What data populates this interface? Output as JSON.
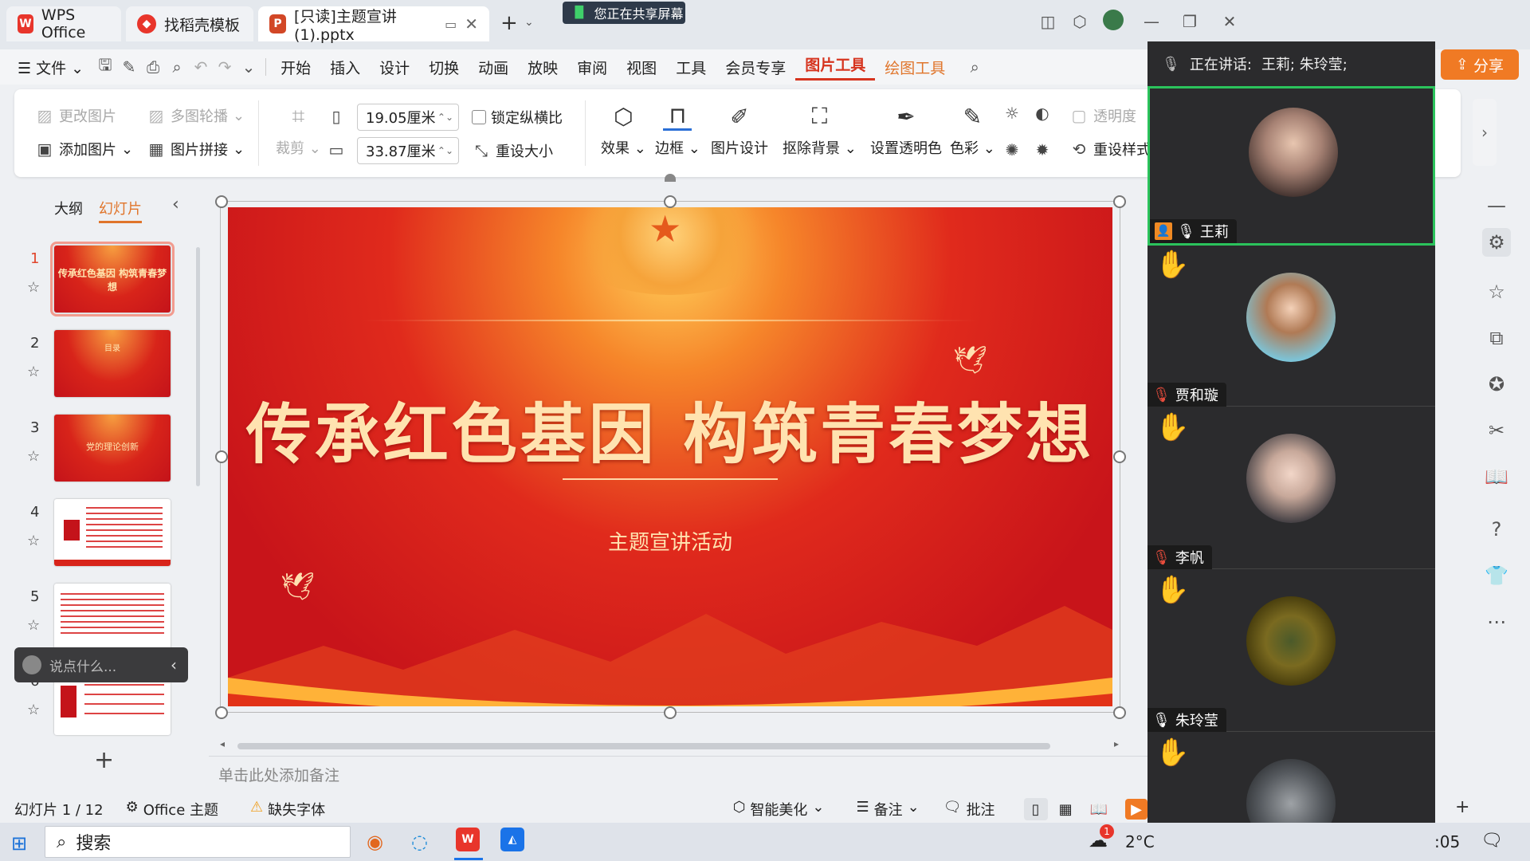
{
  "titlebar": {
    "tabs": [
      {
        "label": "WPS Office",
        "icon": "wps-logo"
      },
      {
        "label": "找稻壳模板",
        "icon": "docer-logo"
      },
      {
        "label": "[只读]主题宣讲(1).pptx",
        "icon": "pptx-logo"
      }
    ],
    "sharing_label": "您正在共享屏幕",
    "new_tab": "+",
    "share_button": "分享"
  },
  "menubar": {
    "file": "文件",
    "items": [
      "开始",
      "插入",
      "设计",
      "切换",
      "动画",
      "放映",
      "审阅",
      "视图",
      "工具",
      "会员专享",
      "图片工具",
      "绘图工具"
    ],
    "active": "图片工具"
  },
  "ribbon": {
    "change_picture": "更改图片",
    "multi_carousel": "多图轮播",
    "add_picture": "添加图片",
    "picture_splice": "图片拼接",
    "crop": "裁剪",
    "height_value": "19.05厘米",
    "width_value": "33.87厘米",
    "lock_ratio": "锁定纵横比",
    "reset_size": "重设大小",
    "effects": "效果",
    "border": "边框",
    "picture_design": "图片设计",
    "remove_background": "抠除背景",
    "set_transparent": "设置透明色",
    "color": "色彩",
    "transparency": "透明度",
    "reset_style": "重设样式"
  },
  "leftpanel": {
    "outline_tab": "大纲",
    "slides_tab": "幻灯片",
    "slides": [
      {
        "num": "1",
        "text": "传承红色基因 构筑青春梦想"
      },
      {
        "num": "2",
        "text": "目录"
      },
      {
        "num": "3",
        "text": "党的理论创新"
      },
      {
        "num": "4",
        "text": ""
      },
      {
        "num": "5",
        "text": ""
      },
      {
        "num": "6",
        "text": ""
      }
    ],
    "chat_placeholder": "说点什么...",
    "add_slide": "+"
  },
  "slide": {
    "title": "传承红色基因 构筑青春梦想",
    "subtitle": "主题宣讲活动"
  },
  "notes_placeholder": "单击此处添加备注",
  "meeting": {
    "speaking_label": "正在讲话:",
    "speaking_names": "王莉; 朱玲莹;",
    "participants": [
      {
        "name": "王莉",
        "mic": "on",
        "hand": false
      },
      {
        "name": "贾和璇",
        "mic": "muted",
        "hand": true
      },
      {
        "name": "李帆",
        "mic": "muted",
        "hand": true
      },
      {
        "name": "朱玲莹",
        "mic": "on",
        "hand": true
      },
      {
        "name": "",
        "mic": "",
        "hand": true
      }
    ]
  },
  "statusbar": {
    "slide_count": "幻灯片 1 / 12",
    "theme": "Office 主题",
    "missing_font": "缺失字体",
    "smart_beautify": "智能美化",
    "notes": "备注",
    "comments": "批注"
  },
  "taskbar": {
    "search": "搜索",
    "weather": "2°C",
    "time": ":05",
    "badge": "1"
  }
}
